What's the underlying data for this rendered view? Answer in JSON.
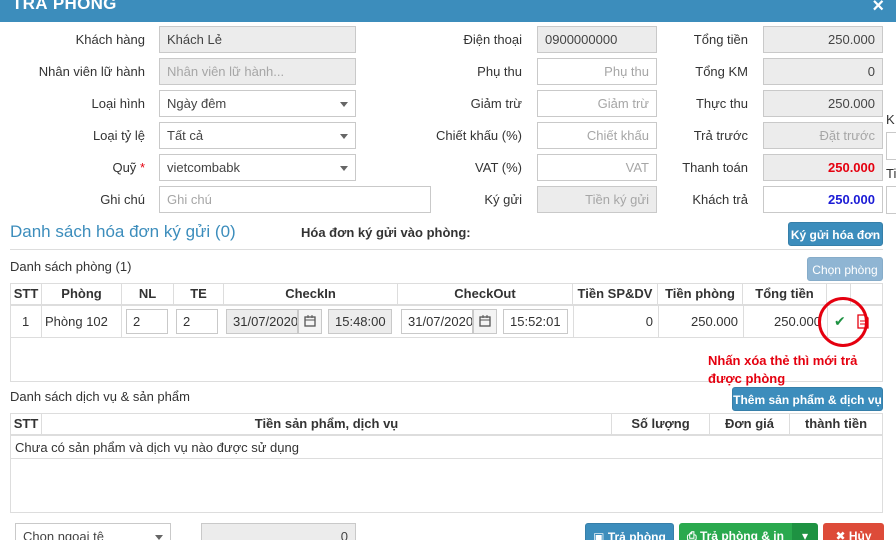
{
  "window": {
    "title": "TRẢ PHÒNG",
    "close_glyph": "×"
  },
  "form": {
    "khach_hang": {
      "label": "Khách hàng",
      "value": "Khách Lẻ"
    },
    "nhan_vien": {
      "label": "Nhân viên lữ hành",
      "placeholder": "Nhân viên lữ hành..."
    },
    "loai_hinh": {
      "label": "Loại hình",
      "value": "Ngày đêm"
    },
    "loai_ty_le": {
      "label": "Loại tỷ lệ",
      "value": "Tất cả"
    },
    "quy": {
      "label": "Quỹ",
      "required_mark": "*",
      "value": "vietcombabk"
    },
    "ghi_chu": {
      "label": "Ghi chú",
      "placeholder": "Ghi chú"
    },
    "dien_thoai": {
      "label": "Điện thoại",
      "value": "0900000000"
    },
    "phu_thu": {
      "label": "Phụ thu",
      "placeholder": "Phụ thu"
    },
    "giam_tru": {
      "label": "Giảm trừ",
      "placeholder": "Giảm trừ"
    },
    "chiet_khau": {
      "label": "Chiết khấu (%)",
      "placeholder": "Chiết khấu"
    },
    "vat": {
      "label": "VAT (%)",
      "placeholder": "VAT"
    },
    "ky_gui": {
      "label": "Ký gửi",
      "placeholder": "Tiền ký gửi"
    },
    "tong_tien": {
      "label": "Tổng tiền",
      "value": "250.000"
    },
    "tong_km": {
      "label": "Tổng KM",
      "value": "0"
    },
    "thuc_thu": {
      "label": "Thực thu",
      "value": "250.000"
    },
    "tra_truoc": {
      "label": "Trả trước",
      "placeholder": "Đặt trước"
    },
    "thanh_toan": {
      "label": "Thanh toán",
      "value": "250.000"
    },
    "khach_tra": {
      "label": "Khách trả",
      "value": "250.000"
    }
  },
  "side_partial": {
    "k": "K",
    "t": "Ti"
  },
  "deposit": {
    "title": "Danh sách hóa đơn ký gửi (0)",
    "subtitle": "Hóa đơn ký gửi vào phòng:",
    "button": "Ký gửi hóa đơn"
  },
  "rooms": {
    "title": "Danh sách phòng (1)",
    "button": "Chọn phòng",
    "headers": [
      "STT",
      "Phòng",
      "NL",
      "TE",
      "CheckIn",
      "CheckOut",
      "Tiền SP&DV",
      "Tiền phòng",
      "Tổng tiền"
    ],
    "row": {
      "stt": "1",
      "phong": "Phòng 102",
      "nl": "2",
      "te": "2",
      "checkin_date": "31/07/2020",
      "checkin_time": "15:48:00",
      "checkout_date": "31/07/2020",
      "checkout_time": "15:52:01",
      "tien_sp_dv": "0",
      "tien_phong": "250.000",
      "tong_tien": "250.000"
    }
  },
  "annotation": "Nhấn xóa thẻ thì mới trả được phòng",
  "services": {
    "title": "Danh sách dịch vụ & sản phẩm",
    "button": "Thêm sản phẩm & dịch vụ",
    "headers": [
      "STT",
      "Tiền sản phẩm, dịch vụ",
      "Số lượng",
      "Đơn giá",
      "thành tiền"
    ],
    "empty_text": "Chưa có sản phẩm và dịch vụ nào được sử dụng"
  },
  "footer": {
    "currency": "Chọn ngoại tệ",
    "amount": "0",
    "btn_checkout": "Trả phòng",
    "btn_checkout_print": "Trả phòng & in",
    "btn_cancel": "Hủy"
  },
  "colors": {
    "primary": "#3c8dbc",
    "danger": "#e5000f",
    "success": "#1e9242",
    "total_blue": "#1b1bd6"
  }
}
